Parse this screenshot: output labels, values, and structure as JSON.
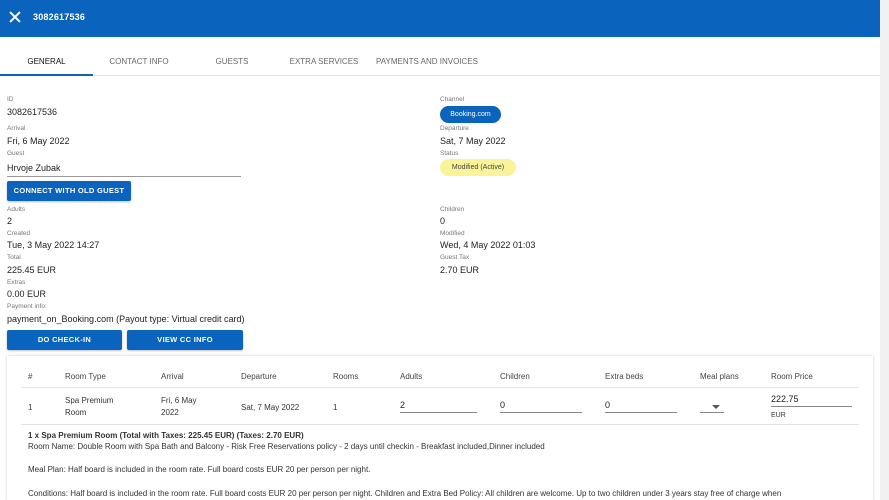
{
  "header": {
    "title": "3082617536"
  },
  "tabs": [
    {
      "label": "GENERAL"
    },
    {
      "label": "CONTACT INFO"
    },
    {
      "label": "GUESTS"
    },
    {
      "label": "EXTRA SERVICES"
    },
    {
      "label": "PAYMENTS AND INVOICES"
    }
  ],
  "general": {
    "id_label": "ID",
    "id": "3082617536",
    "channel_label": "Channel",
    "channel": "Booking.com",
    "arrival_label": "Arrival",
    "arrival": "Fri, 6 May 2022",
    "departure_label": "Departure",
    "departure": "Sat, 7 May 2022",
    "guest_label": "Guest",
    "guest": "Hrvoje Zubak",
    "status_label": "Status",
    "status": "Modified (Active)",
    "connect_button": "CONNECT WITH OLD GUEST",
    "adults_label": "Adults",
    "adults": "2",
    "children_label": "Children",
    "children": "0",
    "created_label": "Created",
    "created": "Tue, 3 May 2022 14:27",
    "modified_label": "Modified",
    "modified": "Wed, 4 May 2022 01:03",
    "total_label": "Total",
    "total": "225.45 EUR",
    "guest_tax_label": "Guest Tax",
    "guest_tax": "2.70 EUR",
    "extras_label": "Extras",
    "extras": "0.00 EUR",
    "payment_info_label": "Payment info:",
    "payment_info": "payment_on_Booking.com (Payout type: Virtual credit card)",
    "checkin_button": "DO CHECK-IN",
    "view_cc_button": "VIEW CC INFO"
  },
  "rooms_table": {
    "headers": [
      "#",
      "Room Type",
      "Arrival",
      "Departure",
      "Rooms",
      "Adults",
      "Children",
      "Extra beds",
      "Meal plans",
      "Room Price"
    ],
    "row": {
      "num": "1",
      "room_type_line1": "Spa Premium",
      "room_type_line2": "Room",
      "arrival_line1": "Fri, 6 May",
      "arrival_line2": "2022",
      "departure": "Sat, 7 May 2022",
      "rooms": "1",
      "adults": "2",
      "children": "0",
      "extra_beds": "0",
      "room_price": "222.75",
      "currency": "EUR"
    }
  },
  "notes": {
    "summary": "1 x Spa Premium Room (Total with Taxes: 225.45 EUR) (Taxes: 2.70 EUR)",
    "room_name": "Room Name: Double Room with Spa Bath and Balcony - Risk Free Reservations policy - 2 days until checkin - Breakfast included,Dinner included",
    "meal_plan": "Meal Plan: Half board is included in the room rate. Full board costs EUR 20 per person per night.",
    "conditions": "Conditions: Half board is included in the room rate. Full board costs EUR 20 per person per night. Children and Extra Bed Policy: All children are welcome. Up to two children under 3 years stay free of charge when"
  },
  "colors": {
    "primary": "#0a63bd",
    "status_chip": "#faf39a"
  }
}
